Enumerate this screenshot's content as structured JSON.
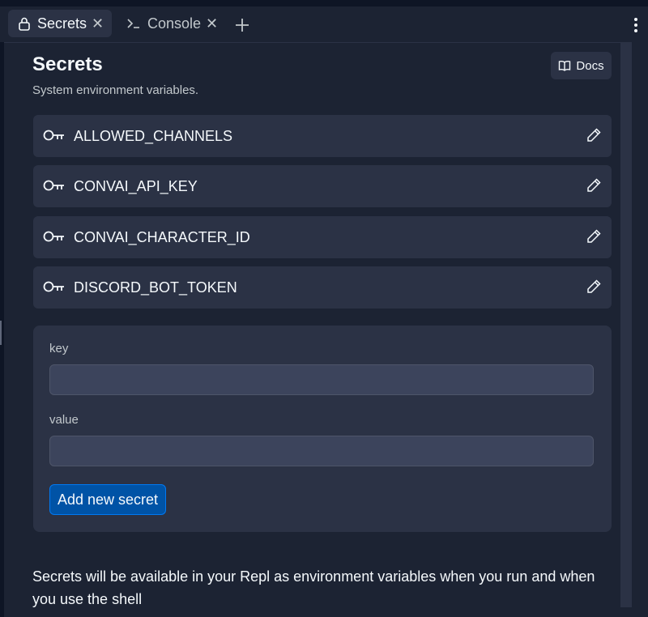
{
  "tabs": [
    {
      "label": "Secrets",
      "icon": "lock-icon",
      "active": true
    },
    {
      "label": "Console",
      "icon": "terminal-icon",
      "active": false
    }
  ],
  "header": {
    "title": "Secrets",
    "subtitle": "System environment variables.",
    "docs_label": "Docs"
  },
  "secrets": [
    {
      "name": "ALLOWED_CHANNELS"
    },
    {
      "name": "CONVAI_API_KEY"
    },
    {
      "name": "CONVAI_CHARACTER_ID"
    },
    {
      "name": "DISCORD_BOT_TOKEN"
    }
  ],
  "form": {
    "key_label": "key",
    "key_value": "",
    "value_label": "value",
    "value_value": "",
    "submit_label": "Add new secret"
  },
  "footer": {
    "note": "Secrets will be available in your Repl as environment variables when you run and when you use the shell"
  },
  "colors": {
    "background": "#1c2333",
    "surface": "#2b3245",
    "accent": "#0053a6"
  }
}
